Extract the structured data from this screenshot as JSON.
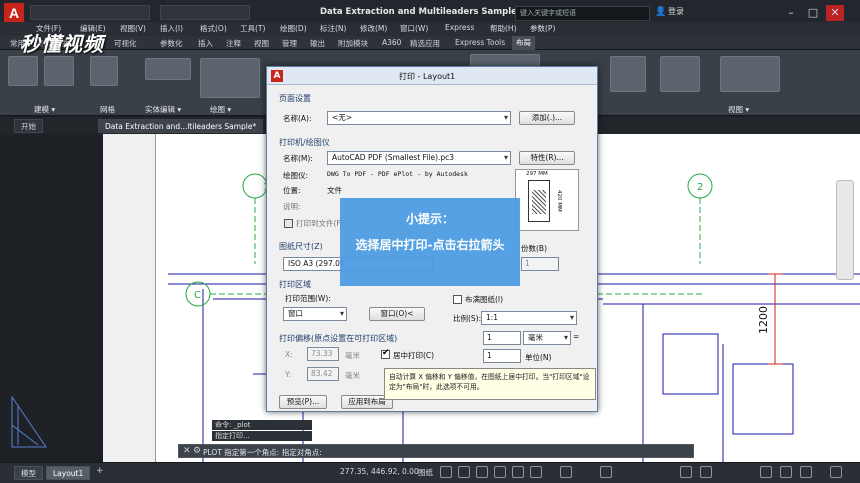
{
  "app": {
    "title": "Data Extraction and Multileaders Sample.dwg",
    "search_placeholder": "键入关键字或短语",
    "signin": "登录"
  },
  "watermark": "秒懂视频",
  "menubar": [
    "文件(F)",
    "编辑(E)",
    "视图(V)",
    "插入(I)",
    "格式(O)",
    "工具(T)",
    "绘图(D)",
    "标注(N)",
    "修改(M)",
    "窗口(W)",
    "Express",
    "帮助(H)",
    "参数(P)"
  ],
  "ribbon_tabs": [
    "常用",
    "实体",
    "曲面",
    "网格",
    "可视化",
    "参数化",
    "插入",
    "注释",
    "视图",
    "管理",
    "输出",
    "附加模块",
    "A360",
    "精选应用",
    "Express Tools",
    "布局"
  ],
  "ribbon_panels": [
    "建模 ▾",
    "网格",
    "实体编辑 ▾",
    "绘图 ▾",
    "视图 ▾"
  ],
  "file_tabs": [
    "开始",
    "Data Extraction and...ltileaders Sample*"
  ],
  "drawing": {
    "grid_markers": [
      "1",
      "2",
      "C"
    ],
    "dimension": "1200"
  },
  "dialog": {
    "title": "打印 - Layout1",
    "page_setup": {
      "group": "页面设置",
      "name_label": "名称(A):",
      "name_value": "<无>",
      "add_button": "添加(.)..."
    },
    "printer": {
      "group": "打印机/绘图仪",
      "name_label": "名称(M):",
      "name_value": "AutoCAD PDF (Smallest File).pc3",
      "properties_button": "特性(R)...",
      "plotter_label": "绘图仪:",
      "plotter_value": "DWG To PDF - PDF ePlot - by Autodesk",
      "location_label": "位置:",
      "location_value": "文件",
      "desc_label": "说明:",
      "print_to_file": "打印到文件(F)",
      "paper_preview_width": "297 MM",
      "paper_preview_height": "420 MM"
    },
    "paper_size": {
      "group": "图纸尺寸(Z)",
      "value": "ISO A3 (297.00"
    },
    "copies": {
      "label": "份数(B)",
      "value": "1"
    },
    "plot_area": {
      "group": "打印区域",
      "range_label": "打印范围(W):",
      "range_value": "窗口",
      "window_button": "窗口(O)<"
    },
    "plot_offset": {
      "group": "打印偏移(原点设置在可打印区域)",
      "x_label": "X:",
      "x_value": "73.33",
      "x_unit": "毫米",
      "y_label": "Y:",
      "y_value": "83.42",
      "y_unit": "毫米",
      "center_label": "居中打印(C)"
    },
    "plot_scale": {
      "fit_label": "布满图纸(I)",
      "scale_label": "比例(S):",
      "scale_value": "1:1",
      "value1": "1",
      "unit1": "毫米",
      "value2": "1",
      "unit2": "单位(N)"
    },
    "buttons": {
      "preview": "预览(P)...",
      "apply": "应用到布局"
    }
  },
  "tooltip": "自动计算 X 偏移和 Y 偏移值，在图纸上居中打印。当\"打印区域\"设定为\"布局\"时，此选项不可用。",
  "overlay": {
    "line1": "小提示：",
    "line2": "选择居中打印-点击右拉箭头"
  },
  "command": {
    "history1": "命令: _plot",
    "history2": "指定打印...",
    "prompt": "PLOT 指定第一个角点: 指定对角点:"
  },
  "status": {
    "tabs": [
      "模型",
      "Layout1"
    ],
    "coords": "277.35, 446.92, 0.00",
    "mode": "图纸"
  }
}
